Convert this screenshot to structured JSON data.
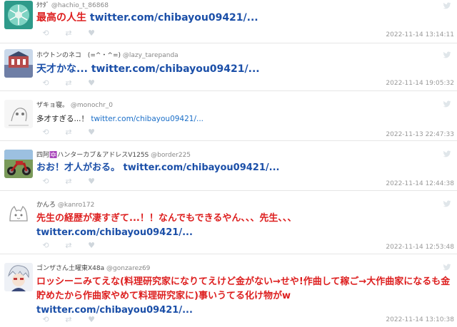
{
  "tweets": [
    {
      "name": "ﾀｹﾀﾞ",
      "handle": "@hachio_t_86868",
      "text": "最高の人生",
      "link": "twitter.com/chibayou09421/...",
      "time": "2022-11-14 13:14:11",
      "avatar": "snowflake-pattern"
    },
    {
      "name": "ホウトンのネコ　(=^・^=)",
      "handle": "@lazy_tarepanda",
      "text": "天才かな...",
      "link": "twitter.com/chibayou09421/...",
      "time": "2022-11-14 19:05:32",
      "avatar": "building-photo"
    },
    {
      "name": "ザキョ寝。",
      "handle": "@monochr_0",
      "text": "多才すぎる...！",
      "link": "twitter.com/chibayou09421/...",
      "time": "2022-11-13 22:47:33",
      "avatar": "sketch-drawing"
    },
    {
      "name": "四阿🔯ハンターカブ＆アドレスV125S",
      "handle": "@border225",
      "text": "おお！才人がおる。",
      "link": "twitter.com/chibayou09421/...",
      "time": "2022-11-14 12:44:38",
      "avatar": "motorcycle-photo"
    },
    {
      "name": "かんろ",
      "handle": "@kanro172",
      "text": "先生の経歴が凄すぎて...！！なんでもできるやん、、、先生、、、",
      "link": "twitter.com/chibayou09421/...",
      "time": "2022-11-14 12:53:48",
      "avatar": "cat-drawing"
    },
    {
      "name": "ゴンザさん土曜東X48a",
      "handle": "@gonzarez69",
      "text": "ロッシーニみてえな(料理研究家になりてえけど金がない→せや!作曲して稼ご→大作曲家になるも金貯めたから作曲家やめて料理研究家に)事いうてる化け物がw",
      "link": "twitter.com/chibayou09421/...",
      "time": "2022-11-14 13:10:38",
      "avatar": "anime-character"
    }
  ],
  "colors": {
    "highlight_text": "#dd1f1f",
    "link": "#1b4fa8",
    "muted": "#888888",
    "action_icons": "#cfd6dc"
  },
  "icons": {
    "reply": "reply-icon",
    "retweet": "retweet-icon",
    "like": "heart-icon",
    "source": "twitter-bird-icon"
  }
}
